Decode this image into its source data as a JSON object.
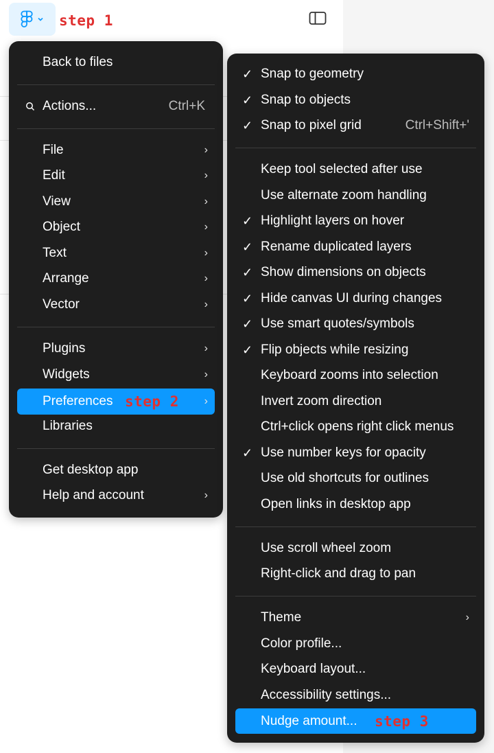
{
  "toolbar": {
    "logo_icon": "figma-logo-icon",
    "chevron_icon": "chevron-down-icon",
    "step1": "step 1",
    "panel_toggle_icon": "sidebar-panel-icon"
  },
  "main_menu": {
    "back": "Back to files",
    "actions": "Actions...",
    "actions_shortcut": "Ctrl+K",
    "file": "File",
    "edit": "Edit",
    "view": "View",
    "object": "Object",
    "text": "Text",
    "arrange": "Arrange",
    "vector": "Vector",
    "plugins": "Plugins",
    "widgets": "Widgets",
    "preferences": "Preferences",
    "step2": "step 2",
    "libraries": "Libraries",
    "desktop": "Get desktop app",
    "help": "Help and account"
  },
  "preferences_menu": {
    "check_mark": "✓",
    "chevron": "›",
    "snap_geometry": "Snap to geometry",
    "snap_objects": "Snap to objects",
    "snap_pixel": "Snap to pixel grid",
    "snap_pixel_shortcut": "Ctrl+Shift+'",
    "keep_tool": "Keep tool selected after use",
    "alt_zoom": "Use alternate zoom handling",
    "highlight_layers": "Highlight layers on hover",
    "rename_dup": "Rename duplicated layers",
    "show_dims": "Show dimensions on objects",
    "hide_canvas": "Hide canvas UI during changes",
    "smart_quotes": "Use smart quotes/symbols",
    "flip_objects": "Flip objects while resizing",
    "kb_zoom": "Keyboard zooms into selection",
    "invert_zoom": "Invert zoom direction",
    "ctrl_click": "Ctrl+click opens right click menus",
    "number_keys": "Use number keys for opacity",
    "old_shortcuts": "Use old shortcuts for outlines",
    "open_links": "Open links in desktop app",
    "scroll_zoom": "Use scroll wheel zoom",
    "right_drag": "Right-click and drag to pan",
    "theme": "Theme",
    "color_profile": "Color profile...",
    "kb_layout": "Keyboard layout...",
    "accessibility": "Accessibility settings...",
    "nudge": "Nudge amount...",
    "step3": "step 3"
  },
  "colors": {
    "menu_bg": "#1e1e1e",
    "highlight": "#0d99ff",
    "step_label": "#e03131",
    "logo_bg": "#e5f4ff"
  }
}
